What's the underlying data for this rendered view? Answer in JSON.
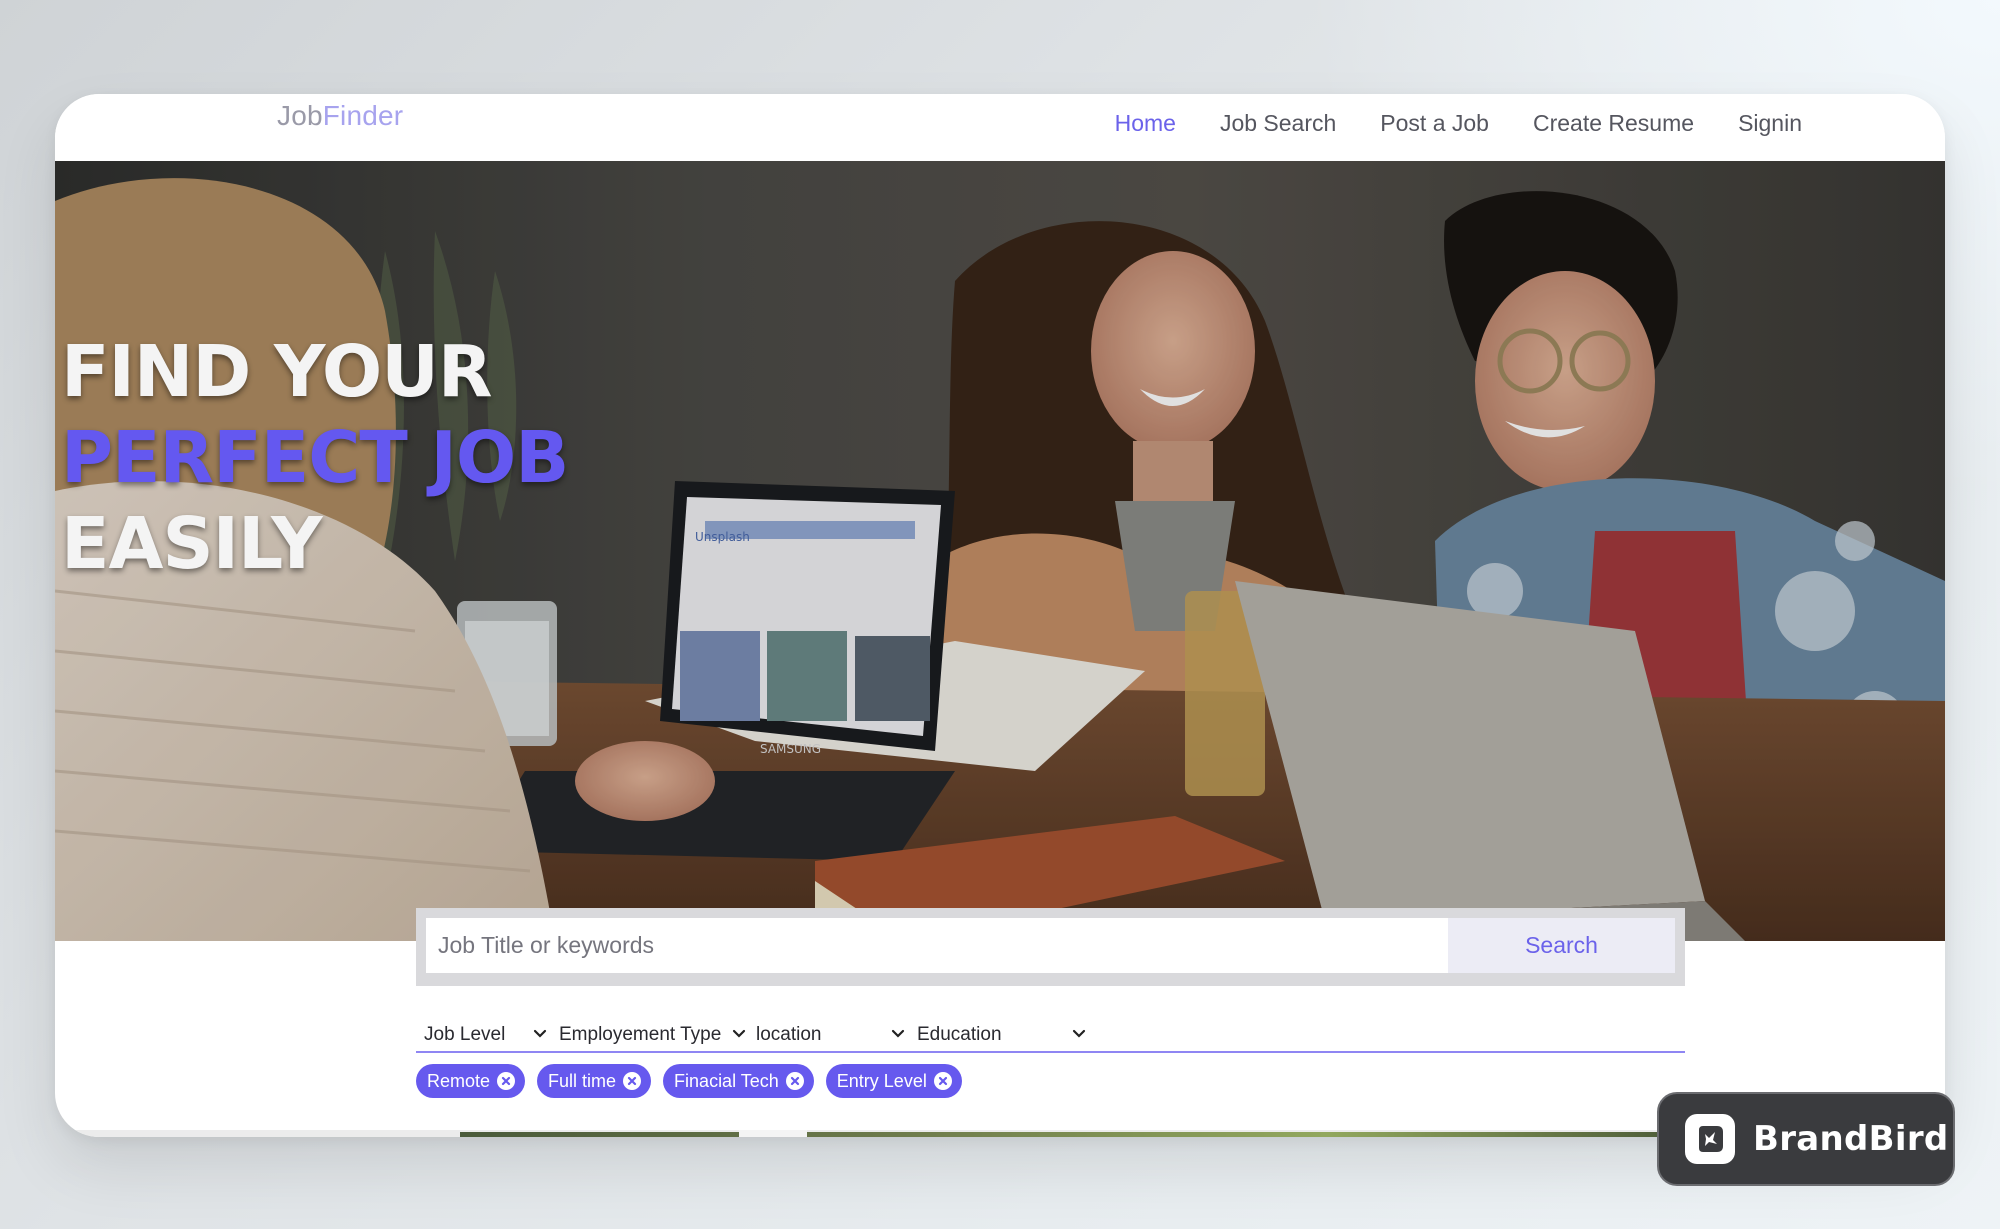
{
  "navbar": {
    "brand_part1": "Job",
    "brand_part2": "Finder",
    "links": [
      "Home",
      "Job Search",
      "Post a Job",
      "Create Resume",
      "Signin"
    ],
    "active_link": "Home"
  },
  "hero": {
    "line1": "FIND YOUR",
    "line2": "PERFECT JOB",
    "line3": "EASILY",
    "laptop_brand": "SAMSUNG",
    "laptop_screen_label": "Unsplash"
  },
  "search": {
    "placeholder": "Job Title or keywords",
    "button_label": "Search"
  },
  "filters": [
    "Job Level",
    "Employement Type",
    "location",
    "Education"
  ],
  "chips": [
    "Remote",
    "Full time",
    "Finacial Tech",
    "Entry Level"
  ],
  "badge": {
    "name": "BrandBird"
  },
  "colors": {
    "accent": "#6b62ea",
    "chip": "#6659ee",
    "headline_highlight": "#6458f0",
    "nav_text": "#55565f",
    "badge_bg": "#3a3b3e"
  },
  "icons": [
    "chevron-down-icon",
    "close-circle-icon",
    "brandbird-logo-icon"
  ]
}
